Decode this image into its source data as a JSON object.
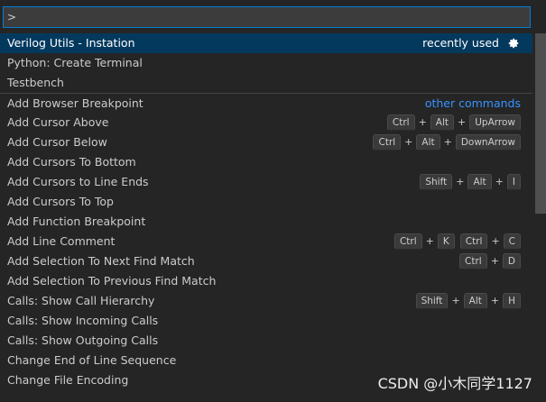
{
  "input": {
    "value": ">"
  },
  "top_items": [
    {
      "label": "Verilog Utils - Instation",
      "badge": "recently used",
      "selected": true
    },
    {
      "label": "Python: Create Terminal"
    },
    {
      "label": "Testbench"
    }
  ],
  "other_commands_label": "other commands",
  "commands": [
    {
      "label": "Add Browser Breakpoint",
      "keys": []
    },
    {
      "label": "Add Cursor Above",
      "keys": [
        [
          "Ctrl",
          "Alt",
          "UpArrow"
        ]
      ]
    },
    {
      "label": "Add Cursor Below",
      "keys": [
        [
          "Ctrl",
          "Alt",
          "DownArrow"
        ]
      ]
    },
    {
      "label": "Add Cursors To Bottom",
      "keys": []
    },
    {
      "label": "Add Cursors to Line Ends",
      "keys": [
        [
          "Shift",
          "Alt",
          "I"
        ]
      ]
    },
    {
      "label": "Add Cursors To Top",
      "keys": []
    },
    {
      "label": "Add Function Breakpoint",
      "keys": []
    },
    {
      "label": "Add Line Comment",
      "keys": [
        [
          "Ctrl",
          "K"
        ],
        [
          "Ctrl",
          "C"
        ]
      ]
    },
    {
      "label": "Add Selection To Next Find Match",
      "keys": [
        [
          "Ctrl",
          "D"
        ]
      ]
    },
    {
      "label": "Add Selection To Previous Find Match",
      "keys": []
    },
    {
      "label": "Calls: Show Call Hierarchy",
      "keys": [
        [
          "Shift",
          "Alt",
          "H"
        ]
      ]
    },
    {
      "label": "Calls: Show Incoming Calls",
      "keys": []
    },
    {
      "label": "Calls: Show Outgoing Calls",
      "keys": []
    },
    {
      "label": "Change End of Line Sequence",
      "keys": []
    },
    {
      "label": "Change File Encoding",
      "keys": []
    }
  ],
  "icons": {
    "settings": "gear-icon"
  },
  "watermark": "CSDN @小木同学1127",
  "colors": {
    "accent_border": "#007fd4",
    "selected_row": "#04395e",
    "link": "#3794ff",
    "background": "#252526"
  }
}
